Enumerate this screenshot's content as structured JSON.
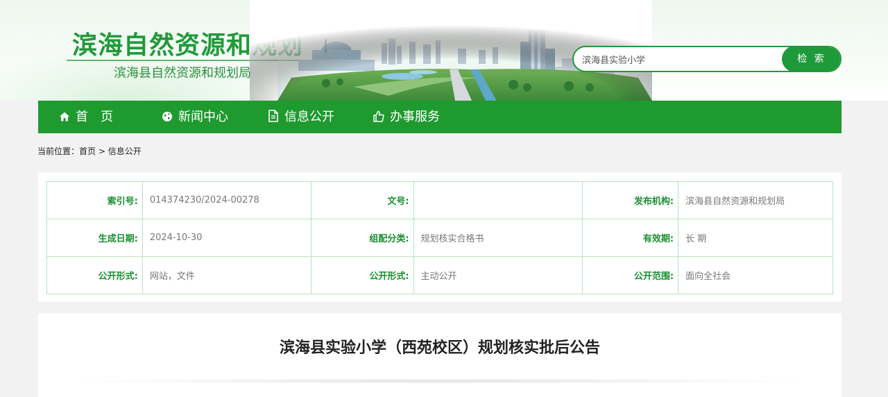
{
  "header": {
    "site_title": "滨海自然资源和规划",
    "site_subtitle": "滨海县自然资源和规划局"
  },
  "search": {
    "value": "滨海县实验小学",
    "button_label": "检 索"
  },
  "nav": {
    "items": [
      {
        "label": "首　页",
        "icon": "home-icon"
      },
      {
        "label": "新闻中心",
        "icon": "globe-icon"
      },
      {
        "label": "信息公开",
        "icon": "document-icon"
      },
      {
        "label": "办事服务",
        "icon": "thumbs-up-icon"
      }
    ]
  },
  "breadcrumb": {
    "prefix": "当前位置：",
    "home": "首页",
    "separator": " > ",
    "current": "信息公开"
  },
  "info": {
    "rows": [
      [
        {
          "label": "索引号:",
          "value": "014374230/2024-00278"
        },
        {
          "label": "文号:",
          "value": ""
        },
        {
          "label": "发布机构:",
          "value": "滨海县自然资源和规划局"
        }
      ],
      [
        {
          "label": "生成日期:",
          "value": "2024-10-30"
        },
        {
          "label": "组配分类:",
          "value": "规划核实合格书"
        },
        {
          "label": "有效期:",
          "value": "长 期"
        }
      ],
      [
        {
          "label": "公开形式:",
          "value": "网站，文件"
        },
        {
          "label": "公开形式:",
          "value": "主动公开"
        },
        {
          "label": "公开范围:",
          "value": "面向全社会"
        }
      ]
    ]
  },
  "article": {
    "title": "滨海县实验小学（西苑校区）规划核实批后公告"
  },
  "colors": {
    "brand_green": "#1f9a2f",
    "label_green": "#1a8f30",
    "table_border": "#b8e2c0"
  }
}
